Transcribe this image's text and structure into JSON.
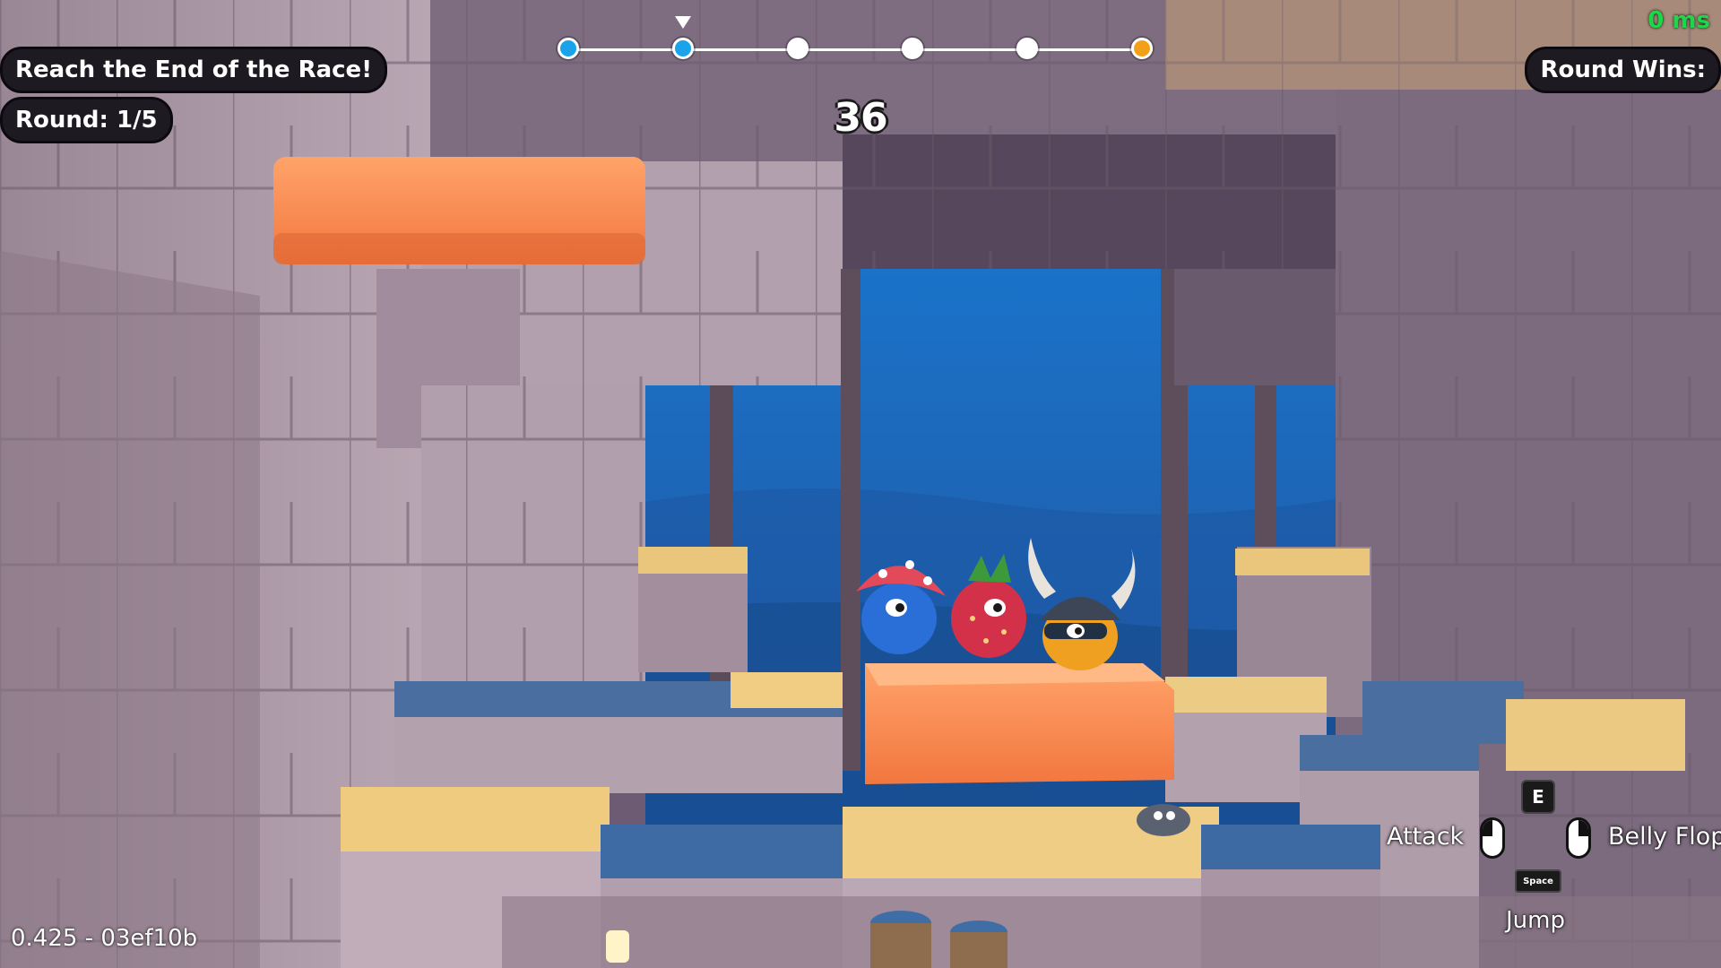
{
  "hud": {
    "objective": "Reach the End of the Race!",
    "round": "Round: 1/5",
    "round_wins": "Round Wins:",
    "ping": "0 ms",
    "timer": "36",
    "version": "0.425 - 03ef10b"
  },
  "race_progress": {
    "checkpoints": 6,
    "reached": 2,
    "player_at": 2,
    "colors": {
      "reached": "#1aa3e8",
      "pending": "#ffffff",
      "goal": "#f2a019"
    }
  },
  "controls": {
    "attack": {
      "label": "Attack",
      "key": "E",
      "mouse": "left-mouse-icon"
    },
    "belly_flop": {
      "label": "Belly Flop",
      "mouse": "right-mouse-icon"
    },
    "jump": {
      "label": "Jump",
      "key": "Space"
    }
  },
  "characters": [
    {
      "name": "mushroom-cap-creature"
    },
    {
      "name": "strawberry-creature"
    },
    {
      "name": "viking-helmet-creature"
    }
  ]
}
